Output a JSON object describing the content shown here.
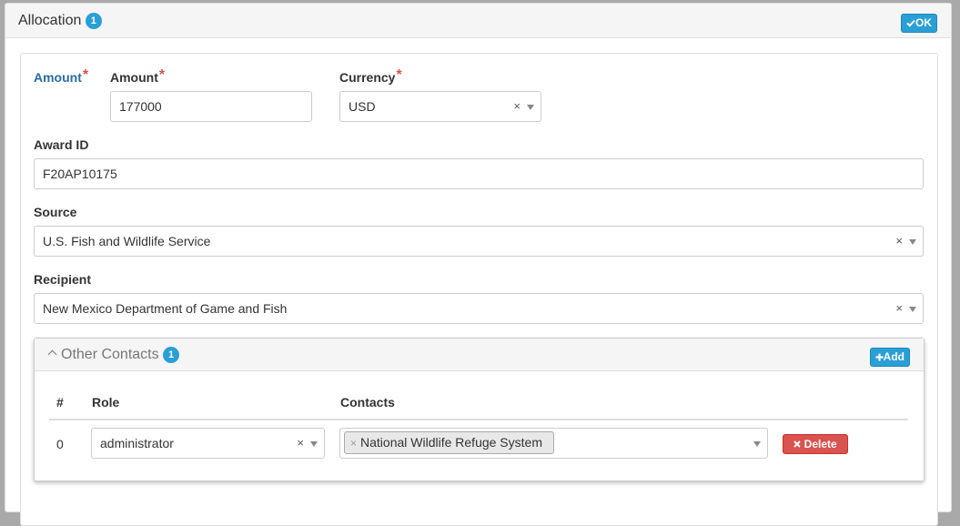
{
  "header": {
    "title": "Allocation",
    "badge": "1",
    "ok_label": "OK",
    "ok_icon": "check-icon"
  },
  "form": {
    "amount_section_label": "Amount",
    "amount": {
      "label": "Amount",
      "value": "177000",
      "required": true
    },
    "currency": {
      "label": "Currency",
      "value": "USD",
      "required": true
    },
    "award_id": {
      "label": "Award ID",
      "value": "F20AP10175"
    },
    "source": {
      "label": "Source",
      "value": "U.S. Fish and Wildlife Service"
    },
    "recipient": {
      "label": "Recipient",
      "value": "New Mexico Department of Game and Fish"
    },
    "required_marker": "*",
    "clear_glyph": "×"
  },
  "other_contacts": {
    "title": "Other Contacts",
    "badge": "1",
    "add_label": "Add",
    "columns": [
      "#",
      "Role",
      "Contacts"
    ],
    "rows": [
      {
        "index": "0",
        "role": "administrator",
        "contacts": [
          "National Wildlife Refuge System"
        ],
        "delete_label": "Delete"
      }
    ]
  },
  "colors": {
    "accent": "#2a9fd6",
    "danger": "#d9534f",
    "label_blue": "#2b6c9e"
  }
}
